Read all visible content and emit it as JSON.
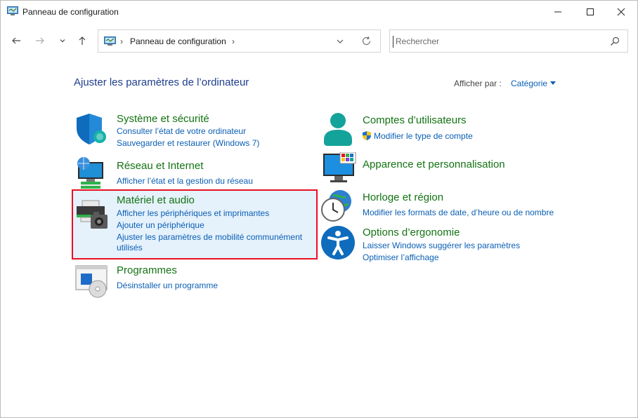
{
  "window": {
    "title": "Panneau de configuration",
    "controls": {
      "minimize": "—",
      "maximize": "☐",
      "close": "✕"
    }
  },
  "address": {
    "path": "Panneau de configuration",
    "separator": "›"
  },
  "search": {
    "placeholder": "Rechercher"
  },
  "header": {
    "title": "Ajuster les paramètres de l’ordinateur",
    "view_by_label": "Afficher par :",
    "view_by_value": "Catégorie"
  },
  "categories": {
    "system": {
      "title": "Système et sécurité",
      "links": [
        "Consulter l’état de votre ordinateur",
        "Sauvegarder et restaurer (Windows 7)"
      ]
    },
    "network": {
      "title": "Réseau et Internet",
      "links": [
        "Afficher l’état et la gestion du réseau"
      ]
    },
    "hardware": {
      "title": "Matériel et audio",
      "links": [
        "Afficher les périphériques et imprimantes",
        "Ajouter un périphérique",
        "Ajuster les paramètres de mobilité communément",
        "utilisés"
      ]
    },
    "programs": {
      "title": "Programmes",
      "links": [
        "Désinstaller un programme"
      ]
    },
    "accounts": {
      "title": "Comptes d’utilisateurs",
      "links": [
        "Modifier le type de compte"
      ]
    },
    "appearance": {
      "title": "Apparence et personnalisation",
      "links": []
    },
    "clock": {
      "title": "Horloge et région",
      "links": [
        "Modifier les formats de date, d’heure ou de nombre"
      ]
    },
    "ease": {
      "title": "Options d’ergonomie",
      "links": [
        "Laisser Windows suggérer les paramètres",
        "Optimiser l’affichage"
      ]
    }
  },
  "colors": {
    "category_title": "#137313",
    "link": "#0a5fb4",
    "page_title": "#1e3d8c",
    "highlight_border": "#e81123"
  }
}
